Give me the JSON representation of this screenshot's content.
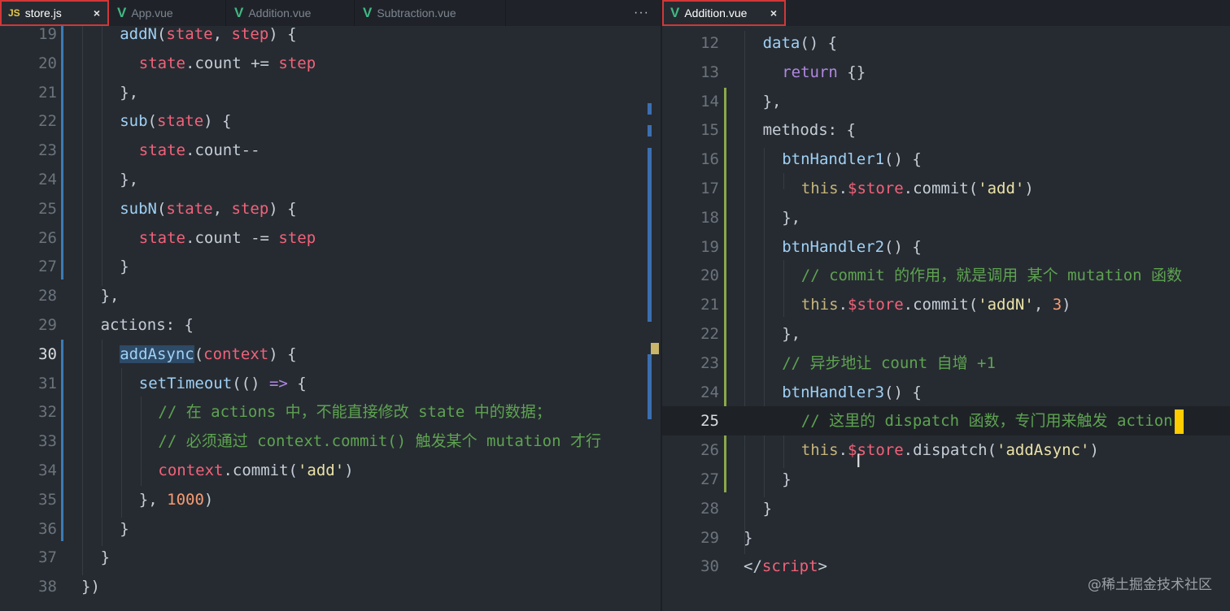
{
  "left_tabs": [
    {
      "icon": "JS",
      "label": "store.js",
      "close": "×"
    },
    {
      "icon": "V",
      "label": "App.vue"
    },
    {
      "icon": "V",
      "label": "Addition.vue"
    },
    {
      "icon": "V",
      "label": "Subtraction.vue"
    }
  ],
  "left_more": "···",
  "right_tab": {
    "icon": "V",
    "label": "Addition.vue",
    "close": "×"
  },
  "watermark": "@稀土掘金技术社区",
  "left_lines": [
    {
      "n": "19",
      "segs": [
        {
          "t": "addN",
          "c": "fn"
        },
        {
          "t": "(",
          "c": "plain"
        },
        {
          "t": "state",
          "c": "param"
        },
        {
          "t": ", ",
          "c": "plain"
        },
        {
          "t": "step",
          "c": "param"
        },
        {
          "t": ") {",
          "c": "plain"
        }
      ]
    },
    {
      "n": "20",
      "segs": [
        {
          "t": "state",
          "c": "param"
        },
        {
          "t": ".count += ",
          "c": "plain"
        },
        {
          "t": "step",
          "c": "param"
        }
      ]
    },
    {
      "n": "21",
      "segs": [
        {
          "t": "},",
          "c": "plain"
        }
      ]
    },
    {
      "n": "22",
      "segs": [
        {
          "t": "sub",
          "c": "fn"
        },
        {
          "t": "(",
          "c": "plain"
        },
        {
          "t": "state",
          "c": "param"
        },
        {
          "t": ") {",
          "c": "plain"
        }
      ]
    },
    {
      "n": "23",
      "segs": [
        {
          "t": "state",
          "c": "param"
        },
        {
          "t": ".count--",
          "c": "plain"
        }
      ]
    },
    {
      "n": "24",
      "segs": [
        {
          "t": "},",
          "c": "plain"
        }
      ]
    },
    {
      "n": "25",
      "segs": [
        {
          "t": "subN",
          "c": "fn"
        },
        {
          "t": "(",
          "c": "plain"
        },
        {
          "t": "state",
          "c": "param"
        },
        {
          "t": ", ",
          "c": "plain"
        },
        {
          "t": "step",
          "c": "param"
        },
        {
          "t": ") {",
          "c": "plain"
        }
      ]
    },
    {
      "n": "26",
      "segs": [
        {
          "t": "state",
          "c": "param"
        },
        {
          "t": ".count -= ",
          "c": "plain"
        },
        {
          "t": "step",
          "c": "param"
        }
      ]
    },
    {
      "n": "27",
      "segs": [
        {
          "t": "}",
          "c": "plain"
        }
      ]
    },
    {
      "n": "28",
      "segs": [
        {
          "t": "},",
          "c": "plain"
        }
      ]
    },
    {
      "n": "29",
      "segs": [
        {
          "t": "actions: {",
          "c": "plain"
        }
      ]
    },
    {
      "n": "30",
      "segs": [
        {
          "t": "addAsync",
          "c": "fn-hl"
        },
        {
          "t": "(",
          "c": "plain"
        },
        {
          "t": "context",
          "c": "param"
        },
        {
          "t": ") {",
          "c": "plain"
        }
      ]
    },
    {
      "n": "31",
      "segs": [
        {
          "t": "setTimeout",
          "c": "fn"
        },
        {
          "t": "(() ",
          "c": "plain"
        },
        {
          "t": "=>",
          "c": "kw"
        },
        {
          "t": " {",
          "c": "plain"
        }
      ]
    },
    {
      "n": "32",
      "segs": [
        {
          "t": "// 在 actions 中，不能直接修改 state 中的数据；",
          "c": "cm"
        }
      ]
    },
    {
      "n": "33",
      "segs": [
        {
          "t": "// 必须通过 context.commit() 触发某个 mutation 才行",
          "c": "cm"
        }
      ]
    },
    {
      "n": "34",
      "segs": [
        {
          "t": "context",
          "c": "param"
        },
        {
          "t": ".commit(",
          "c": "plain"
        },
        {
          "t": "'add'",
          "c": "str"
        },
        {
          "t": ")",
          "c": "plain"
        }
      ]
    },
    {
      "n": "35",
      "segs": [
        {
          "t": "}, ",
          "c": "plain"
        },
        {
          "t": "1000",
          "c": "num"
        },
        {
          "t": ")",
          "c": "plain"
        }
      ]
    },
    {
      "n": "36",
      "segs": [
        {
          "t": "}",
          "c": "plain"
        }
      ]
    },
    {
      "n": "37",
      "segs": [
        {
          "t": "}",
          "c": "plain"
        }
      ]
    },
    {
      "n": "38",
      "segs": [
        {
          "t": "})",
          "c": "plain"
        }
      ]
    }
  ],
  "right_lines": [
    {
      "n": "12",
      "segs": [
        {
          "t": "data",
          "c": "fn"
        },
        {
          "t": "() {",
          "c": "plain"
        }
      ]
    },
    {
      "n": "13",
      "segs": [
        {
          "t": "return",
          "c": "kw"
        },
        {
          "t": " {}",
          "c": "plain"
        }
      ]
    },
    {
      "n": "14",
      "segs": [
        {
          "t": "},",
          "c": "plain"
        }
      ]
    },
    {
      "n": "15",
      "segs": [
        {
          "t": "methods: {",
          "c": "plain"
        }
      ]
    },
    {
      "n": "16",
      "segs": [
        {
          "t": "btnHandler1",
          "c": "fn"
        },
        {
          "t": "() {",
          "c": "plain"
        }
      ]
    },
    {
      "n": "17",
      "segs": [
        {
          "t": "this",
          "c": "this"
        },
        {
          "t": ".",
          "c": "plain"
        },
        {
          "t": "$store",
          "c": "param"
        },
        {
          "t": ".commit(",
          "c": "plain"
        },
        {
          "t": "'add'",
          "c": "str"
        },
        {
          "t": ")",
          "c": "plain"
        }
      ]
    },
    {
      "n": "18",
      "segs": [
        {
          "t": "},",
          "c": "plain"
        }
      ]
    },
    {
      "n": "19",
      "segs": [
        {
          "t": "btnHandler2",
          "c": "fn"
        },
        {
          "t": "() {",
          "c": "plain"
        }
      ]
    },
    {
      "n": "20",
      "segs": [
        {
          "t": "// commit 的作用，就是调用 某个 mutation 函数",
          "c": "cm"
        }
      ]
    },
    {
      "n": "21",
      "segs": [
        {
          "t": "this",
          "c": "this"
        },
        {
          "t": ".",
          "c": "plain"
        },
        {
          "t": "$store",
          "c": "param"
        },
        {
          "t": ".commit(",
          "c": "plain"
        },
        {
          "t": "'addN'",
          "c": "str"
        },
        {
          "t": ", ",
          "c": "plain"
        },
        {
          "t": "3",
          "c": "num"
        },
        {
          "t": ")",
          "c": "plain"
        }
      ]
    },
    {
      "n": "22",
      "segs": [
        {
          "t": "},",
          "c": "plain"
        }
      ]
    },
    {
      "n": "23",
      "segs": [
        {
          "t": "// 异步地让 count 自增 +1",
          "c": "cm"
        }
      ]
    },
    {
      "n": "24",
      "segs": [
        {
          "t": "btnHandler3",
          "c": "fn"
        },
        {
          "t": "() {",
          "c": "plain"
        }
      ]
    },
    {
      "n": "25",
      "segs": [
        {
          "t": "// 这里的 dispatch 函数，专门用来触发 action",
          "c": "cm"
        }
      ]
    },
    {
      "n": "26",
      "segs": [
        {
          "t": "this",
          "c": "this"
        },
        {
          "t": ".",
          "c": "plain"
        },
        {
          "t": "$store",
          "c": "param"
        },
        {
          "t": ".dispatch(",
          "c": "plain"
        },
        {
          "t": "'addAsync'",
          "c": "str"
        },
        {
          "t": ")",
          "c": "plain"
        }
      ]
    },
    {
      "n": "27",
      "segs": [
        {
          "t": "}",
          "c": "plain"
        }
      ]
    },
    {
      "n": "28",
      "segs": [
        {
          "t": "}",
          "c": "plain"
        }
      ]
    },
    {
      "n": "29",
      "segs": [
        {
          "t": "}",
          "c": "plain"
        }
      ]
    },
    {
      "n": "30",
      "segs": [
        {
          "t": "</",
          "c": "plain"
        },
        {
          "t": "script",
          "c": "param"
        },
        {
          "t": ">",
          "c": "plain"
        }
      ]
    }
  ]
}
